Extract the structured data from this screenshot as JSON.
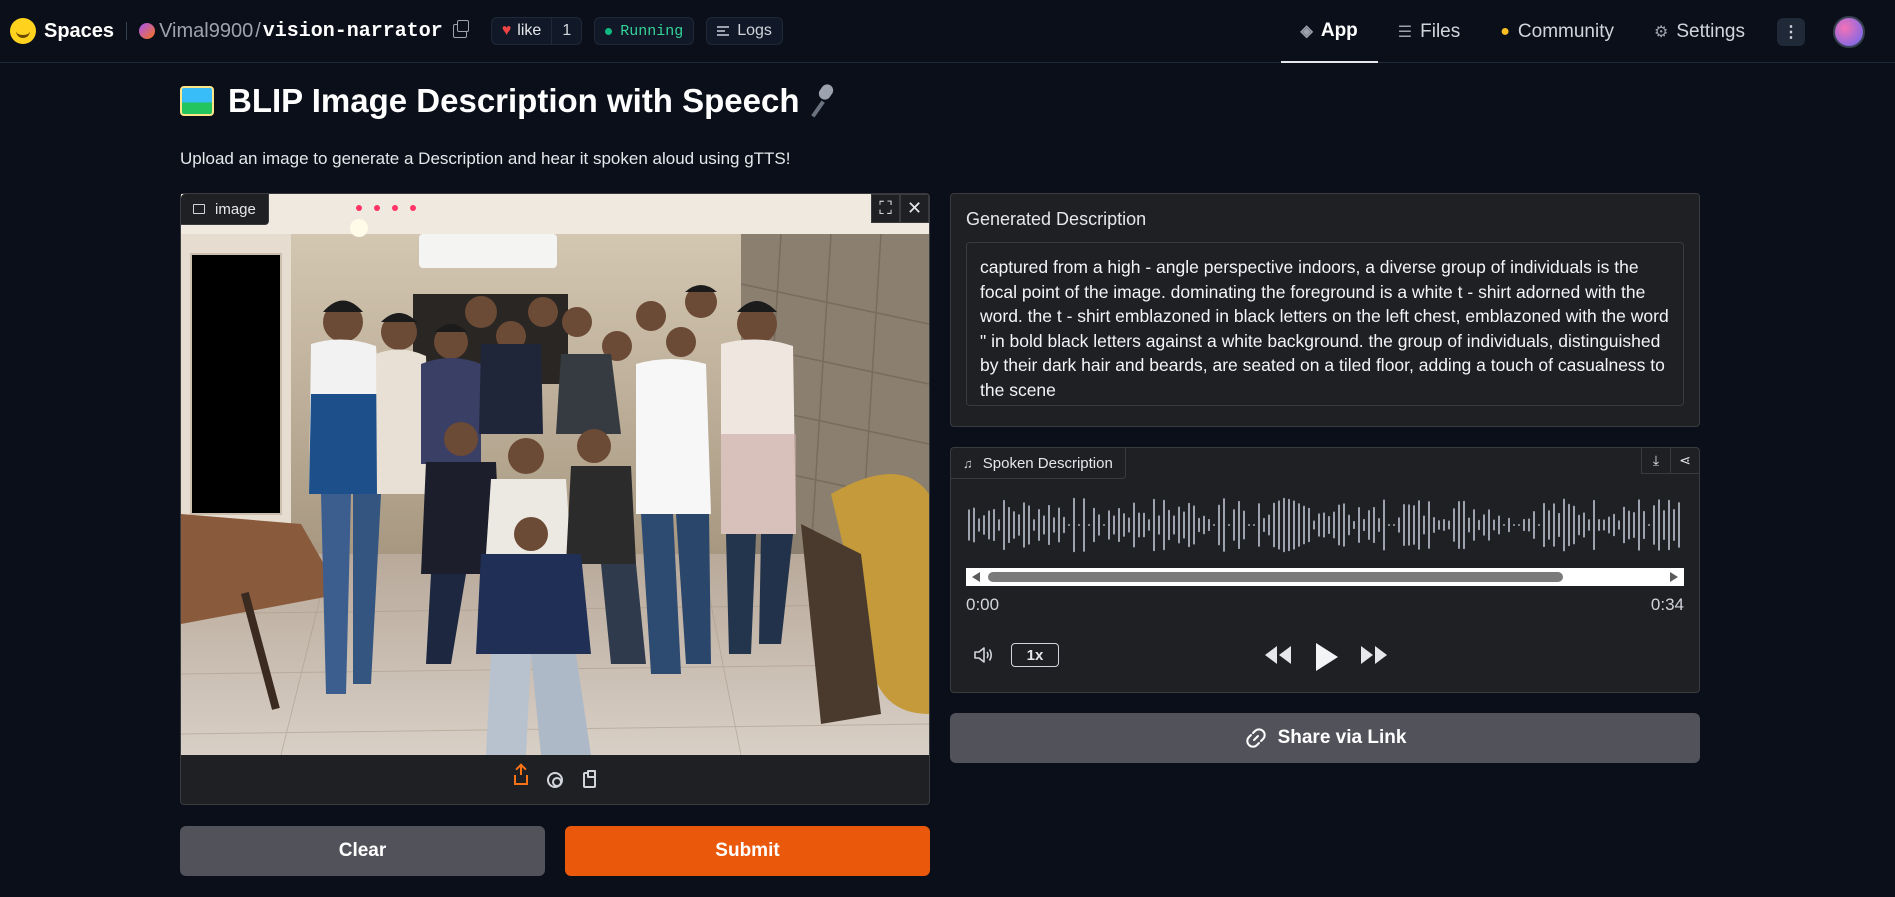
{
  "topbar": {
    "brand": "Spaces",
    "owner": "Vimal9900",
    "slash": "/",
    "repo": "vision-narrator",
    "like_label": "like",
    "like_count": "1",
    "status": "Running",
    "logs_label": "Logs",
    "nav": {
      "app": "App",
      "files": "Files",
      "community": "Community",
      "settings": "Settings"
    },
    "menu_glyph": "⋮"
  },
  "page": {
    "title": "BLIP Image Description with Speech",
    "subtitle": "Upload an image to generate a Description and hear it spoken aloud using gTTS!"
  },
  "image_input": {
    "label": "image"
  },
  "buttons": {
    "clear": "Clear",
    "submit": "Submit",
    "share": "Share via Link"
  },
  "description": {
    "label": "Generated Description",
    "text": "captured from a high - angle perspective indoors, a diverse group of individuals is the focal point of the image. dominating the foreground is a white t - shirt adorned with the word. the t - shirt emblazoned in black letters on the left chest, emblazoned with the word \" in bold black letters against a white background. the group of individuals, distinguished by their dark hair and beards, are seated on a tiled floor, adding a touch of casualness to the scene"
  },
  "audio": {
    "label": "Spoken Description",
    "time_start": "0:00",
    "time_end": "0:34",
    "speed": "1x"
  },
  "icons": {
    "image_label": "image-icon",
    "fullscreen": "fullscreen-icon",
    "close": "close-icon",
    "upload": "upload-icon",
    "webcam": "webcam-icon",
    "clipboard": "clipboard-icon",
    "music": "music-note-icon",
    "download": "download-icon",
    "share": "share-icon",
    "volume": "volume-icon",
    "rewind": "rewind-icon",
    "play": "play-icon",
    "forward": "fast-forward-icon",
    "link": "link-icon"
  },
  "colors": {
    "background": "#0b0f19",
    "panel": "#1f2023",
    "accent": "#ea580c",
    "secondary_button": "#52525b",
    "running": "#34d399"
  }
}
